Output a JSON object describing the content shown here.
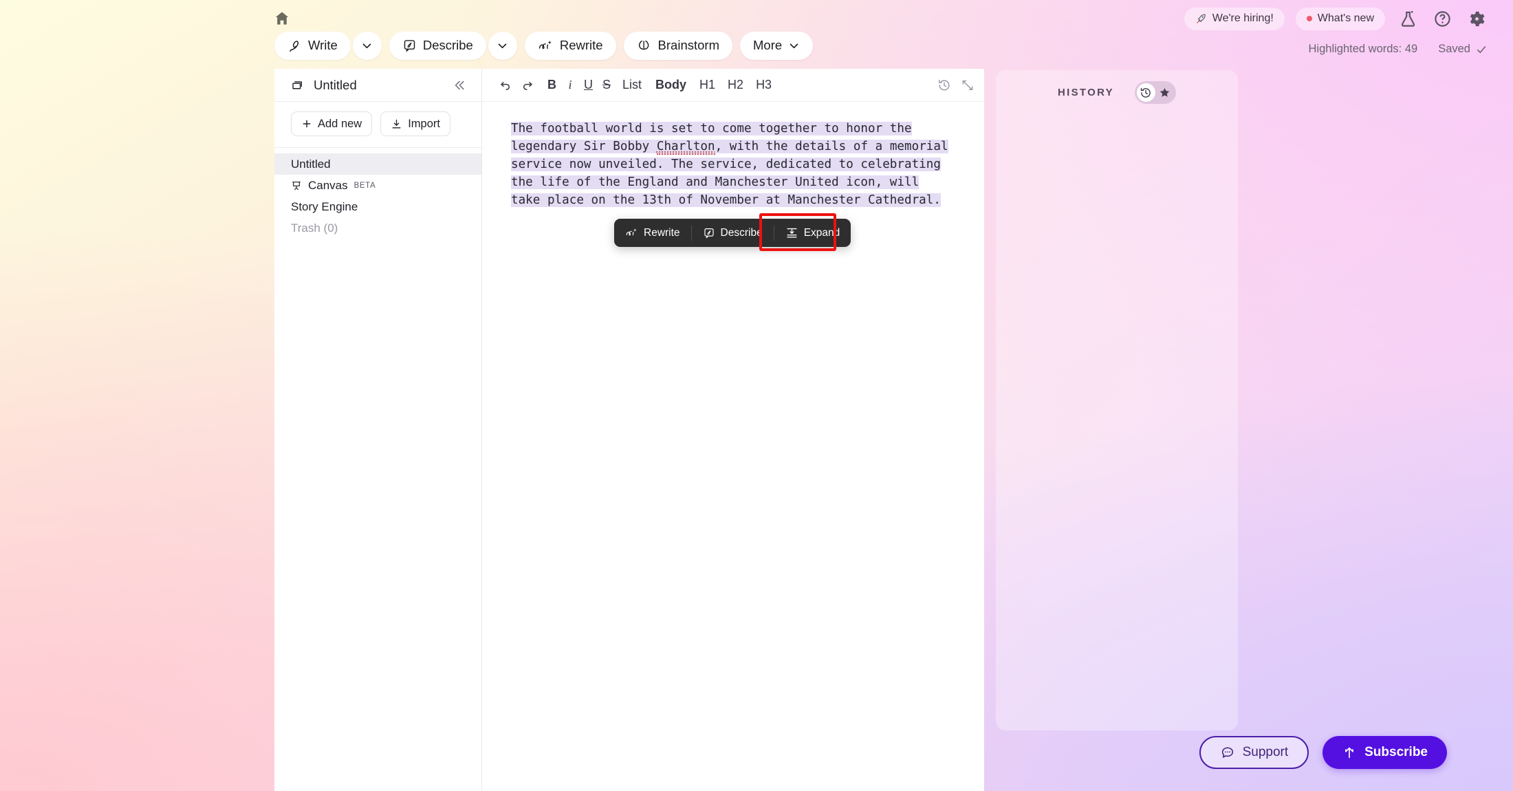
{
  "top_bar": {
    "home_icon": "home-icon",
    "tools": [
      {
        "label": "Write",
        "icon": "quill-icon",
        "has_caret": true
      },
      {
        "label": "Describe",
        "icon": "describe-icon",
        "has_caret": true
      },
      {
        "label": "Rewrite",
        "icon": "rewrite-ai-icon",
        "has_caret": false
      },
      {
        "label": "Brainstorm",
        "icon": "brainstorm-icon",
        "has_caret": false
      },
      {
        "label": "More",
        "icon": "",
        "has_caret": true,
        "inline_caret": true
      }
    ],
    "hiring_label": "We're hiring!",
    "whats_new_label": "What's new",
    "icons": [
      "flask-icon",
      "help-circle-icon",
      "gear-icon"
    ],
    "highlighted_words": "Highlighted words: 49",
    "saved_label": "Saved"
  },
  "sidebar": {
    "title": "Untitled",
    "collapse_icon": "chevrons-left-icon",
    "add_new_label": "Add new",
    "import_label": "Import",
    "items": [
      {
        "label": "Untitled",
        "active": true,
        "icon": ""
      },
      {
        "label": "Canvas",
        "badge": "BETA",
        "icon": "easel-icon"
      },
      {
        "label": "Story Engine",
        "icon": ""
      },
      {
        "label": "Trash (0)",
        "muted": true,
        "icon": ""
      }
    ]
  },
  "editor": {
    "toolbar": {
      "undo": "↶",
      "redo": "↷",
      "bold": "B",
      "italic": "i",
      "underline": "U",
      "strike": "S",
      "list": "List",
      "body": "Body",
      "h1": "H1",
      "h2": "H2",
      "h3": "H3",
      "history_icon": "clock-history-icon",
      "expand_icon": "expand-arrows-icon"
    },
    "document_text_parts": {
      "p1": "The football world is set to come together to honor the legendary Sir Bobby ",
      "misspelled": "Charlton",
      "p2": ", with the details of a memorial service now unveiled. The service, dedicated to celebrating the life of the England and Manchester United icon, will take place on the 13th of November at Manchester Cathedral."
    }
  },
  "context_menu": {
    "items": [
      {
        "label": "Rewrite",
        "icon": "rewrite-ai-icon",
        "highlighted": false
      },
      {
        "label": "Describe",
        "icon": "describe-icon",
        "highlighted": false
      },
      {
        "label": "Expand",
        "icon": "expand-text-icon",
        "highlighted": true
      }
    ],
    "highlight_color": "#ee1111"
  },
  "history_panel": {
    "title": "HISTORY",
    "toggle_left_icon": "clock-history-icon",
    "toggle_right_icon": "star-icon"
  },
  "bottom_actions": {
    "support_label": "Support",
    "support_icon": "chat-dots-icon",
    "subscribe_label": "Subscribe",
    "subscribe_icon": "up-arrow-icon",
    "subscribe_color": "#5410e0"
  }
}
